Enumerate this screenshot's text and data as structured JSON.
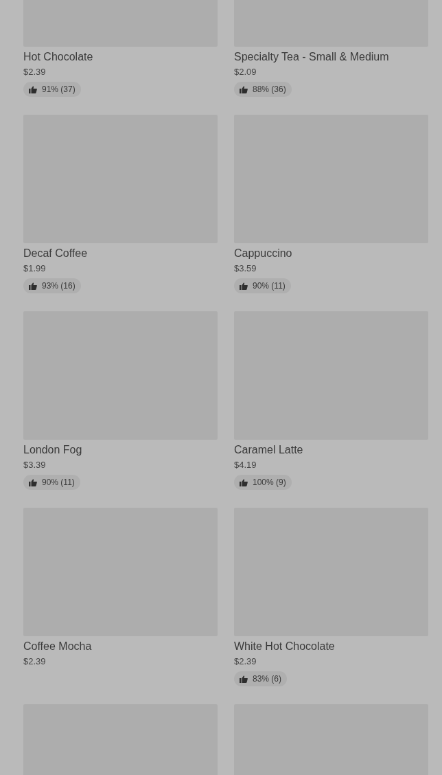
{
  "items": [
    {
      "kind": "product",
      "name": "Hot Chocolate",
      "price": "$2.39",
      "rating": "91% (37)"
    },
    {
      "kind": "product",
      "name": "Specialty Tea - Small & Medium",
      "price": "$2.09",
      "rating": "88% (36)"
    },
    {
      "kind": "product",
      "name": "Decaf Coffee",
      "price": "$1.99",
      "rating": "93% (16)"
    },
    {
      "kind": "product",
      "name": "Cappuccino",
      "price": "$3.59",
      "rating": "90% (11)"
    },
    {
      "kind": "product",
      "name": "London Fog",
      "price": "$3.39",
      "rating": "90% (11)"
    },
    {
      "kind": "product",
      "name": "Caramel Latte",
      "price": "$4.19",
      "rating": "100% (9)"
    },
    {
      "kind": "product",
      "name": "Coffee Mocha",
      "price": "$2.39"
    },
    {
      "kind": "product",
      "name": "White Hot Chocolate",
      "price": "$2.39",
      "rating": "83% (6)"
    },
    {
      "kind": "image-only"
    },
    {
      "kind": "image-only"
    }
  ]
}
